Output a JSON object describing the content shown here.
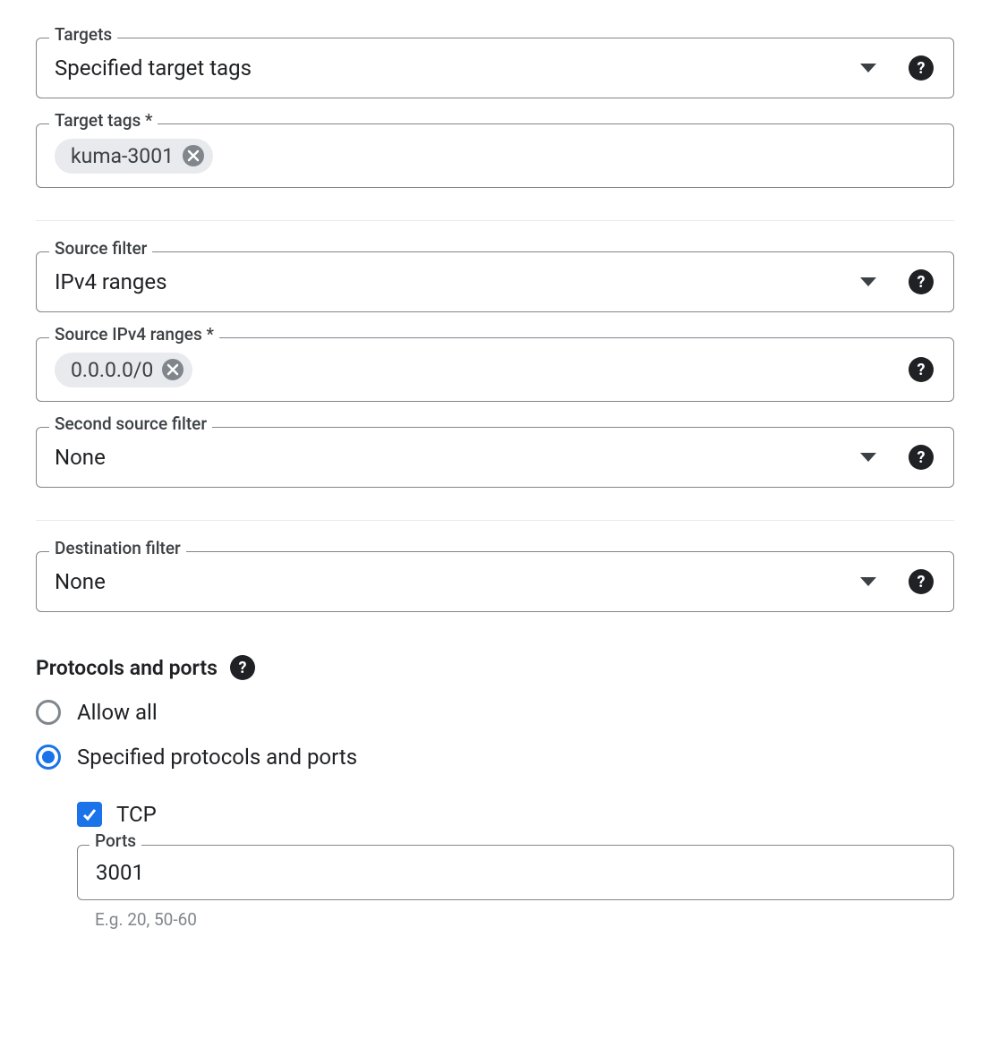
{
  "targets": {
    "label": "Targets",
    "value": "Specified target tags"
  },
  "target_tags": {
    "label": "Target tags *",
    "chips": [
      "kuma-3001"
    ]
  },
  "source_filter": {
    "label": "Source filter",
    "value": "IPv4 ranges"
  },
  "source_ranges": {
    "label": "Source IPv4 ranges *",
    "chips": [
      "0.0.0.0/0"
    ]
  },
  "second_source_filter": {
    "label": "Second source filter",
    "value": "None"
  },
  "destination_filter": {
    "label": "Destination filter",
    "value": "None"
  },
  "protocols": {
    "section_label": "Protocols and ports",
    "radio_allow_all": "Allow all",
    "radio_specified": "Specified protocols and ports",
    "selected": "specified",
    "tcp": {
      "label": "TCP",
      "checked": true,
      "ports_label": "Ports",
      "ports_value": "3001",
      "ports_example": "E.g. 20, 50-60"
    }
  }
}
